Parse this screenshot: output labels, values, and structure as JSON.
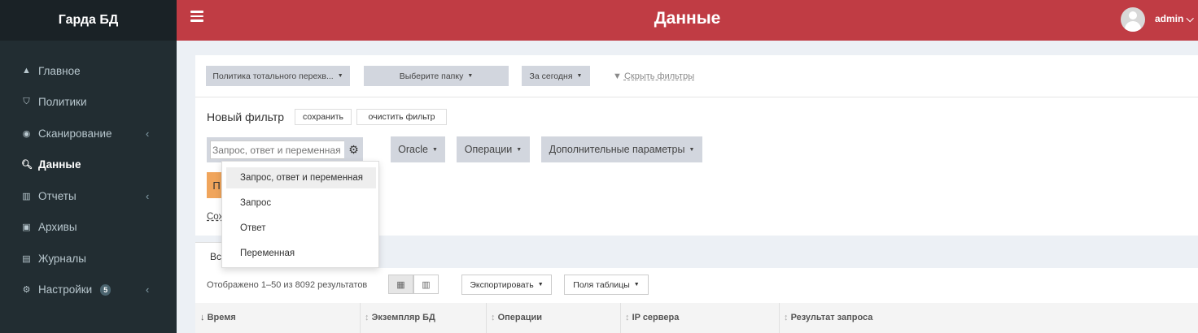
{
  "app": {
    "brand": "Гарда БД"
  },
  "header": {
    "title": "Данные",
    "user": "admin ⌵"
  },
  "sidebar": {
    "items": [
      {
        "label": "Главное",
        "icon": "home-icon",
        "glyph": "🏠"
      },
      {
        "label": "Политики",
        "icon": "shield-icon",
        "glyph": "⛉"
      },
      {
        "label": "Сканирование",
        "icon": "bullseye-icon",
        "glyph": "◉",
        "caret": "‹"
      },
      {
        "label": "Данные",
        "icon": "search-icon",
        "glyph": "🔍"
      },
      {
        "label": "Отчеты",
        "icon": "bar-chart-icon",
        "glyph": "📊",
        "caret": "‹"
      },
      {
        "label": "Архивы",
        "icon": "floppy-icon",
        "glyph": "💾"
      },
      {
        "label": "Журналы",
        "icon": "file-icon",
        "glyph": "📄"
      },
      {
        "label": "Настройки",
        "icon": "gear-icon",
        "glyph": "⚙",
        "badge": "5",
        "caret": "‹"
      }
    ]
  },
  "filters": {
    "policy": "Политика тотального перехв...",
    "folder": "Выберите папку",
    "period": "За сегодня",
    "hide_filters": "Скрыть фильтры",
    "new_filter": "Новый фильтр",
    "save": "сохранить",
    "clear": "очистить фильтр",
    "search_placeholder": "Запрос, ответ и переменная",
    "db_type": "Oracle",
    "operations": "Операции",
    "additional": "Дополнительные параметры",
    "apply_partial": "П",
    "saved_partial": "Сох"
  },
  "search_menu": {
    "options": [
      "Запрос, ответ и переменная",
      "Запрос",
      "Ответ",
      "Переменная"
    ]
  },
  "table": {
    "tab_partial": "Вс",
    "results": "Отображено 1–50 из 8092 результатов",
    "export": "Экспортировать",
    "fields": "Поля таблицы",
    "columns": [
      "Время",
      "Экземпляр БД",
      "Операции",
      "IP сервера",
      "Результат запроса"
    ]
  }
}
